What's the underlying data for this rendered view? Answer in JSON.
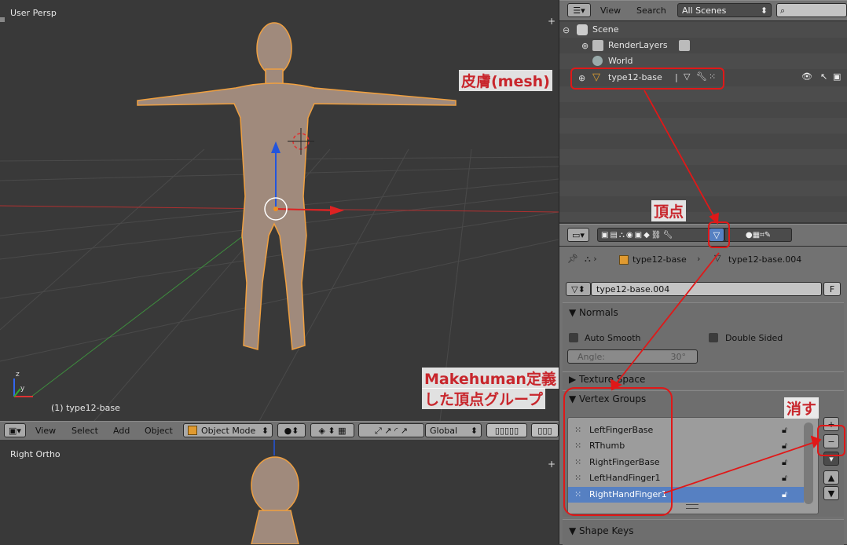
{
  "viewport_top": {
    "label": "User Persp",
    "object_label": "(1) type12-base"
  },
  "viewport_bottom": {
    "label": "Right Ortho"
  },
  "view3d_header": {
    "menus": [
      "View",
      "Select",
      "Add",
      "Object"
    ],
    "mode": "Object Mode",
    "orientation": "Global"
  },
  "outliner": {
    "header": {
      "view": "View",
      "search": "Search",
      "dropdown": "All Scenes"
    },
    "rows": [
      {
        "label": "Scene",
        "icon": "scene-icon"
      },
      {
        "label": "RenderLayers",
        "icon": "renderlayers-icon"
      },
      {
        "label": "World",
        "icon": "world-icon"
      },
      {
        "label": "type12-base",
        "icon": "mesh-object-icon"
      }
    ]
  },
  "properties": {
    "breadcrumb": {
      "object": "type12-base",
      "mesh": "type12-base.004"
    },
    "mesh_name": "type12-base.004",
    "fake_user": "F",
    "normals": {
      "title": "Normals",
      "auto_smooth": "Auto Smooth",
      "double_sided": "Double Sided",
      "angle_label": "Angle:",
      "angle_value": "30°"
    },
    "texture_space": {
      "title": "Texture Space"
    },
    "vertex_groups": {
      "title": "Vertex Groups",
      "items": [
        "LeftFingerBase",
        "RThumb",
        "RightFingerBase",
        "LeftHandFinger1",
        "RightHandFinger1"
      ],
      "selected_index": 4
    },
    "shape_keys": {
      "title": "Shape Keys"
    }
  },
  "annotations": {
    "skin": "皮膚(mesh)",
    "vertex": "頂点",
    "makehuman_line1": "Makehuman定義",
    "makehuman_line2": "した頂点グループ",
    "delete": "消す"
  },
  "colors": {
    "accent_red": "#e01818",
    "selection_blue": "#5680c2",
    "mesh_outline": "#f0a040"
  }
}
